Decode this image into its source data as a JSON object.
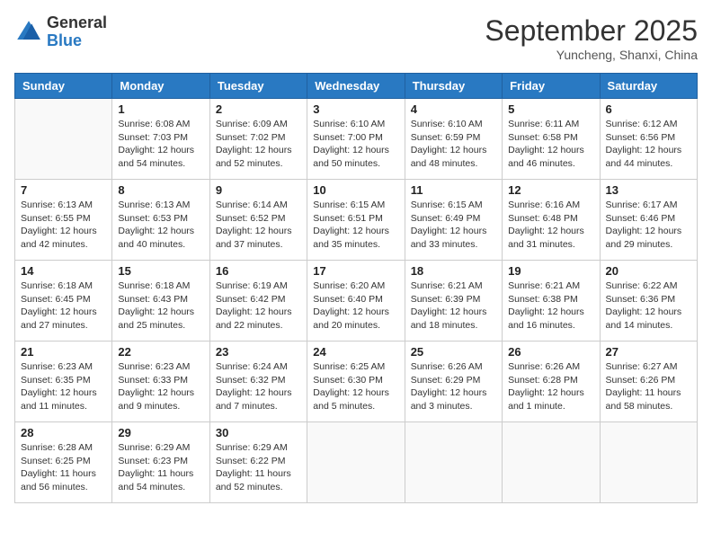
{
  "logo": {
    "general": "General",
    "blue": "Blue"
  },
  "title": "September 2025",
  "subtitle": "Yuncheng, Shanxi, China",
  "headers": [
    "Sunday",
    "Monday",
    "Tuesday",
    "Wednesday",
    "Thursday",
    "Friday",
    "Saturday"
  ],
  "weeks": [
    [
      {
        "day": "",
        "sunrise": "",
        "sunset": "",
        "daylight": ""
      },
      {
        "day": "1",
        "sunrise": "Sunrise: 6:08 AM",
        "sunset": "Sunset: 7:03 PM",
        "daylight": "Daylight: 12 hours and 54 minutes."
      },
      {
        "day": "2",
        "sunrise": "Sunrise: 6:09 AM",
        "sunset": "Sunset: 7:02 PM",
        "daylight": "Daylight: 12 hours and 52 minutes."
      },
      {
        "day": "3",
        "sunrise": "Sunrise: 6:10 AM",
        "sunset": "Sunset: 7:00 PM",
        "daylight": "Daylight: 12 hours and 50 minutes."
      },
      {
        "day": "4",
        "sunrise": "Sunrise: 6:10 AM",
        "sunset": "Sunset: 6:59 PM",
        "daylight": "Daylight: 12 hours and 48 minutes."
      },
      {
        "day": "5",
        "sunrise": "Sunrise: 6:11 AM",
        "sunset": "Sunset: 6:58 PM",
        "daylight": "Daylight: 12 hours and 46 minutes."
      },
      {
        "day": "6",
        "sunrise": "Sunrise: 6:12 AM",
        "sunset": "Sunset: 6:56 PM",
        "daylight": "Daylight: 12 hours and 44 minutes."
      }
    ],
    [
      {
        "day": "7",
        "sunrise": "Sunrise: 6:13 AM",
        "sunset": "Sunset: 6:55 PM",
        "daylight": "Daylight: 12 hours and 42 minutes."
      },
      {
        "day": "8",
        "sunrise": "Sunrise: 6:13 AM",
        "sunset": "Sunset: 6:53 PM",
        "daylight": "Daylight: 12 hours and 40 minutes."
      },
      {
        "day": "9",
        "sunrise": "Sunrise: 6:14 AM",
        "sunset": "Sunset: 6:52 PM",
        "daylight": "Daylight: 12 hours and 37 minutes."
      },
      {
        "day": "10",
        "sunrise": "Sunrise: 6:15 AM",
        "sunset": "Sunset: 6:51 PM",
        "daylight": "Daylight: 12 hours and 35 minutes."
      },
      {
        "day": "11",
        "sunrise": "Sunrise: 6:15 AM",
        "sunset": "Sunset: 6:49 PM",
        "daylight": "Daylight: 12 hours and 33 minutes."
      },
      {
        "day": "12",
        "sunrise": "Sunrise: 6:16 AM",
        "sunset": "Sunset: 6:48 PM",
        "daylight": "Daylight: 12 hours and 31 minutes."
      },
      {
        "day": "13",
        "sunrise": "Sunrise: 6:17 AM",
        "sunset": "Sunset: 6:46 PM",
        "daylight": "Daylight: 12 hours and 29 minutes."
      }
    ],
    [
      {
        "day": "14",
        "sunrise": "Sunrise: 6:18 AM",
        "sunset": "Sunset: 6:45 PM",
        "daylight": "Daylight: 12 hours and 27 minutes."
      },
      {
        "day": "15",
        "sunrise": "Sunrise: 6:18 AM",
        "sunset": "Sunset: 6:43 PM",
        "daylight": "Daylight: 12 hours and 25 minutes."
      },
      {
        "day": "16",
        "sunrise": "Sunrise: 6:19 AM",
        "sunset": "Sunset: 6:42 PM",
        "daylight": "Daylight: 12 hours and 22 minutes."
      },
      {
        "day": "17",
        "sunrise": "Sunrise: 6:20 AM",
        "sunset": "Sunset: 6:40 PM",
        "daylight": "Daylight: 12 hours and 20 minutes."
      },
      {
        "day": "18",
        "sunrise": "Sunrise: 6:21 AM",
        "sunset": "Sunset: 6:39 PM",
        "daylight": "Daylight: 12 hours and 18 minutes."
      },
      {
        "day": "19",
        "sunrise": "Sunrise: 6:21 AM",
        "sunset": "Sunset: 6:38 PM",
        "daylight": "Daylight: 12 hours and 16 minutes."
      },
      {
        "day": "20",
        "sunrise": "Sunrise: 6:22 AM",
        "sunset": "Sunset: 6:36 PM",
        "daylight": "Daylight: 12 hours and 14 minutes."
      }
    ],
    [
      {
        "day": "21",
        "sunrise": "Sunrise: 6:23 AM",
        "sunset": "Sunset: 6:35 PM",
        "daylight": "Daylight: 12 hours and 11 minutes."
      },
      {
        "day": "22",
        "sunrise": "Sunrise: 6:23 AM",
        "sunset": "Sunset: 6:33 PM",
        "daylight": "Daylight: 12 hours and 9 minutes."
      },
      {
        "day": "23",
        "sunrise": "Sunrise: 6:24 AM",
        "sunset": "Sunset: 6:32 PM",
        "daylight": "Daylight: 12 hours and 7 minutes."
      },
      {
        "day": "24",
        "sunrise": "Sunrise: 6:25 AM",
        "sunset": "Sunset: 6:30 PM",
        "daylight": "Daylight: 12 hours and 5 minutes."
      },
      {
        "day": "25",
        "sunrise": "Sunrise: 6:26 AM",
        "sunset": "Sunset: 6:29 PM",
        "daylight": "Daylight: 12 hours and 3 minutes."
      },
      {
        "day": "26",
        "sunrise": "Sunrise: 6:26 AM",
        "sunset": "Sunset: 6:28 PM",
        "daylight": "Daylight: 12 hours and 1 minute."
      },
      {
        "day": "27",
        "sunrise": "Sunrise: 6:27 AM",
        "sunset": "Sunset: 6:26 PM",
        "daylight": "Daylight: 11 hours and 58 minutes."
      }
    ],
    [
      {
        "day": "28",
        "sunrise": "Sunrise: 6:28 AM",
        "sunset": "Sunset: 6:25 PM",
        "daylight": "Daylight: 11 hours and 56 minutes."
      },
      {
        "day": "29",
        "sunrise": "Sunrise: 6:29 AM",
        "sunset": "Sunset: 6:23 PM",
        "daylight": "Daylight: 11 hours and 54 minutes."
      },
      {
        "day": "30",
        "sunrise": "Sunrise: 6:29 AM",
        "sunset": "Sunset: 6:22 PM",
        "daylight": "Daylight: 11 hours and 52 minutes."
      },
      {
        "day": "",
        "sunrise": "",
        "sunset": "",
        "daylight": ""
      },
      {
        "day": "",
        "sunrise": "",
        "sunset": "",
        "daylight": ""
      },
      {
        "day": "",
        "sunrise": "",
        "sunset": "",
        "daylight": ""
      },
      {
        "day": "",
        "sunrise": "",
        "sunset": "",
        "daylight": ""
      }
    ]
  ]
}
